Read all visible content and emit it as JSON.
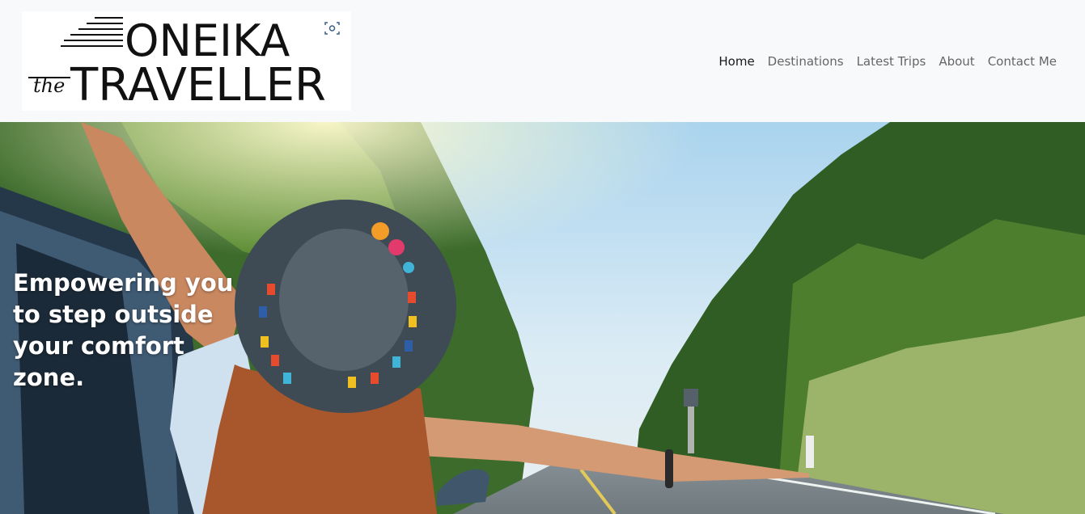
{
  "logo": {
    "line1": "ONEIKA",
    "script": "the",
    "line2": "TRAVELLER"
  },
  "nav": {
    "items": [
      {
        "label": "Home",
        "active": true
      },
      {
        "label": "Destinations",
        "active": false
      },
      {
        "label": "Latest Trips",
        "active": false
      },
      {
        "label": "About",
        "active": false
      },
      {
        "label": "Contact Me",
        "active": false
      }
    ]
  },
  "hero": {
    "headline": "Empowering you to step outside your comfort zone."
  },
  "colors": {
    "navbar_bg": "#f8f9fa",
    "nav_text": "#666666",
    "nav_active": "#1a1a1a",
    "hero_text": "#ffffff"
  }
}
